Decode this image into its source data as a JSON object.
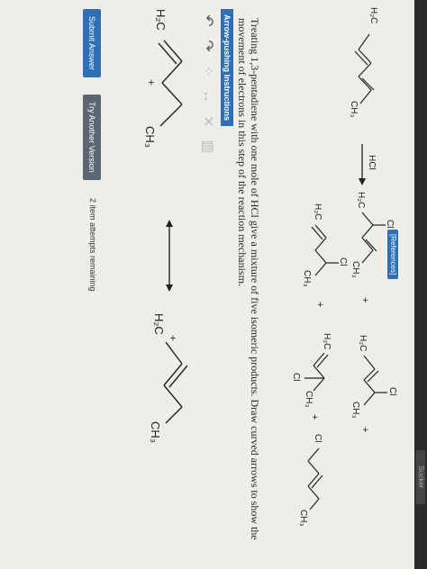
{
  "browser": {
    "tab_text": "Sucker"
  },
  "reference_badge": "[References]",
  "reaction": {
    "reagent": "HCl",
    "reactant": {
      "h2c": "H₂C",
      "ch3": "CH₃"
    },
    "products": [
      {
        "h2c": "H₂C",
        "cl": "Cl",
        "ch3": "CH₃"
      },
      {
        "h2c": "H₂C",
        "cl": "Cl",
        "ch3": "CH₃"
      },
      {
        "h2c": "H₂C",
        "cl": "Cl",
        "ch3": "CH₃"
      },
      {
        "h2c": "H₂C",
        "cl": "Cl",
        "ch3": "CH₃"
      },
      {
        "cl": "Cl",
        "ch3": "CH₃"
      }
    ],
    "plus": "+"
  },
  "problem_text": "Treating 1,3-pentadiene with one mole of HCl give a mixture of five isomeric products. Draw curved arrows to show the movement of electrons in this step of the reaction mechanism.",
  "arrow_instructions_label": "Arrow-pushing Instructions",
  "toolbar_icons": [
    "curved-arrow-icon",
    "curved-arrow-icon",
    "electron-dots-icon",
    "resonance-icon",
    "close-icon",
    "trash-icon"
  ],
  "mechanism": {
    "left": {
      "h2c": "H₂C",
      "ch3": "CH₃",
      "plus": "+"
    },
    "right": {
      "h2c": "H₂C",
      "ch3": "CH₃",
      "plus": "+"
    }
  },
  "buttons": {
    "submit": "Submit Answer",
    "try_another": "Try Another Version"
  },
  "attempts_text": "2 item attempts remaining"
}
